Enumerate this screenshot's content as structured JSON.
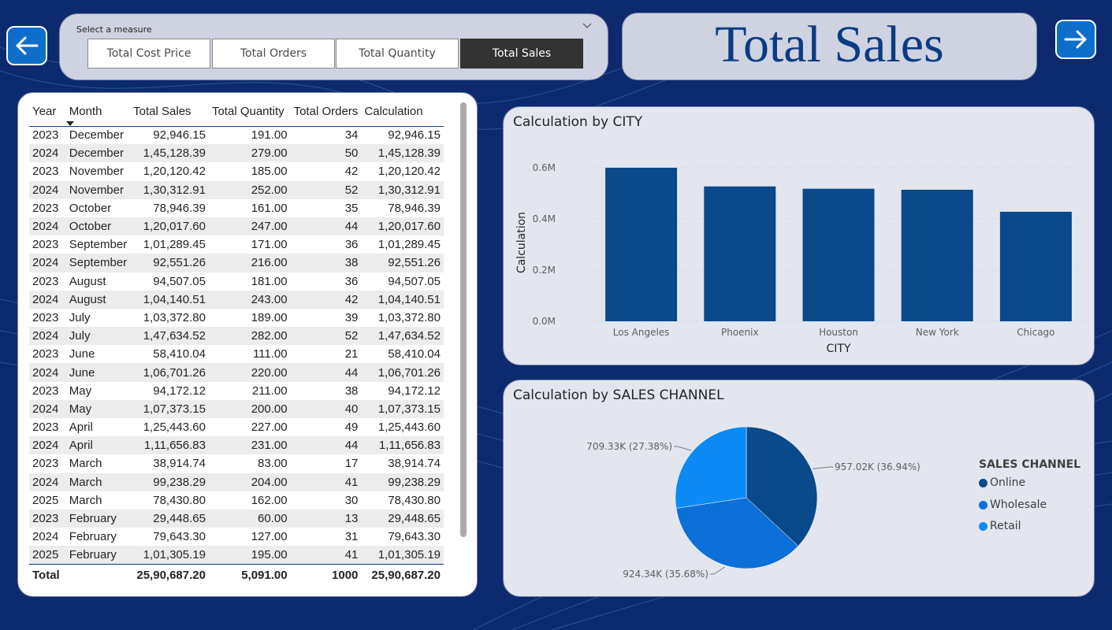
{
  "nav": {
    "back_icon": "arrow-left-icon",
    "forward_icon": "arrow-right-icon"
  },
  "slicer": {
    "label": "Select a measure",
    "options": [
      "Total Cost Price",
      "Total Orders",
      "Total Quantity",
      "Total Sales"
    ],
    "selected": "Total Sales"
  },
  "title": "Total Sales",
  "table": {
    "headers": [
      "Year",
      "Month",
      "Total Sales",
      "Total Quantity",
      "Total Orders",
      "Calculation"
    ],
    "rows": [
      [
        "2023",
        "December",
        "92,946.15",
        "191.00",
        "34",
        "92,946.15"
      ],
      [
        "2024",
        "December",
        "1,45,128.39",
        "279.00",
        "50",
        "1,45,128.39"
      ],
      [
        "2023",
        "November",
        "1,20,120.42",
        "185.00",
        "42",
        "1,20,120.42"
      ],
      [
        "2024",
        "November",
        "1,30,312.91",
        "252.00",
        "52",
        "1,30,312.91"
      ],
      [
        "2023",
        "October",
        "78,946.39",
        "161.00",
        "35",
        "78,946.39"
      ],
      [
        "2024",
        "October",
        "1,20,017.60",
        "247.00",
        "44",
        "1,20,017.60"
      ],
      [
        "2023",
        "September",
        "1,01,289.45",
        "171.00",
        "36",
        "1,01,289.45"
      ],
      [
        "2024",
        "September",
        "92,551.26",
        "216.00",
        "38",
        "92,551.26"
      ],
      [
        "2023",
        "August",
        "94,507.05",
        "181.00",
        "36",
        "94,507.05"
      ],
      [
        "2024",
        "August",
        "1,04,140.51",
        "243.00",
        "42",
        "1,04,140.51"
      ],
      [
        "2023",
        "July",
        "1,03,372.80",
        "189.00",
        "39",
        "1,03,372.80"
      ],
      [
        "2024",
        "July",
        "1,47,634.52",
        "282.00",
        "52",
        "1,47,634.52"
      ],
      [
        "2023",
        "June",
        "58,410.04",
        "111.00",
        "21",
        "58,410.04"
      ],
      [
        "2024",
        "June",
        "1,06,701.26",
        "220.00",
        "44",
        "1,06,701.26"
      ],
      [
        "2023",
        "May",
        "94,172.12",
        "211.00",
        "38",
        "94,172.12"
      ],
      [
        "2024",
        "May",
        "1,07,373.15",
        "200.00",
        "40",
        "1,07,373.15"
      ],
      [
        "2023",
        "April",
        "1,25,443.60",
        "227.00",
        "49",
        "1,25,443.60"
      ],
      [
        "2024",
        "April",
        "1,11,656.83",
        "231.00",
        "44",
        "1,11,656.83"
      ],
      [
        "2023",
        "March",
        "38,914.74",
        "83.00",
        "17",
        "38,914.74"
      ],
      [
        "2024",
        "March",
        "99,238.29",
        "204.00",
        "41",
        "99,238.29"
      ],
      [
        "2025",
        "March",
        "78,430.80",
        "162.00",
        "30",
        "78,430.80"
      ],
      [
        "2023",
        "February",
        "29,448.65",
        "60.00",
        "13",
        "29,448.65"
      ],
      [
        "2024",
        "February",
        "79,643.30",
        "127.00",
        "31",
        "79,643.30"
      ],
      [
        "2025",
        "February",
        "1,01,305.19",
        "195.00",
        "41",
        "1,01,305.19"
      ]
    ],
    "total": [
      "Total",
      "",
      "25,90,687.20",
      "5,091.00",
      "1000",
      "25,90,687.20"
    ],
    "sort_column": "Month",
    "sort_direction": "descending"
  },
  "chart_data": [
    {
      "type": "bar",
      "title": "Calculation by CITY",
      "xlabel": "CITY",
      "ylabel": "Calculation",
      "categories": [
        "Los Angeles",
        "Phoenix",
        "Houston",
        "New York",
        "Chicago"
      ],
      "values": [
        600000,
        527000,
        518000,
        514000,
        428000
      ],
      "ylim": [
        0,
        0.6
      ],
      "yticks": [
        "0.0M",
        "0.2M",
        "0.4M",
        "0.6M"
      ],
      "grid": true,
      "color": "#0a4a8a"
    },
    {
      "type": "pie",
      "title": "Calculation by SALES CHANNEL",
      "legend_title": "SALES CHANNEL",
      "legend_placement": "right",
      "slices": [
        {
          "name": "Online",
          "value": 957.02,
          "label": "957.02K (36.94%)",
          "color": "#0a4a8a"
        },
        {
          "name": "Wholesale",
          "value": 924.34,
          "label": "924.34K (35.68%)",
          "color": "#0d6fd8"
        },
        {
          "name": "Retail",
          "value": 709.33,
          "label": "709.33K (27.38%)",
          "color": "#0c8af5"
        }
      ]
    }
  ]
}
